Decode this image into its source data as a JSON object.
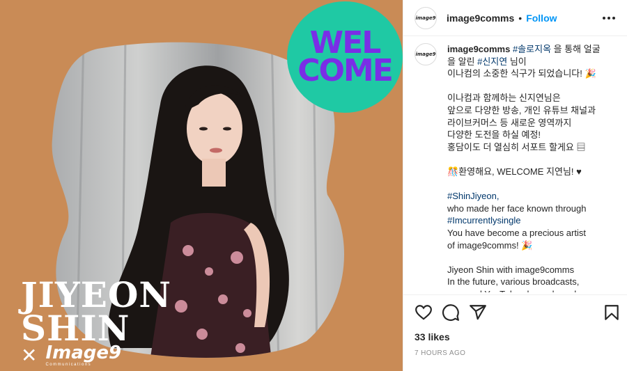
{
  "post": {
    "welcome": [
      "WEL",
      "COME"
    ],
    "name_lines": [
      "JIYEON",
      "SHIN"
    ],
    "x_mark": "✕",
    "brand_name": "Image9",
    "brand_sub": "Communications"
  },
  "header": {
    "avatar_text": "image9",
    "username": "image9comms",
    "separator": "•",
    "follow": "Follow",
    "more_icon": "more-horizontal-icon"
  },
  "caption": {
    "username": "image9comms",
    "lines": [
      [
        {
          "t": " "
        },
        {
          "t": "#솔로지옥",
          "tag": true
        },
        {
          "t": " 을 통해 얼굴"
        }
      ],
      [
        {
          "t": "을 알린 "
        },
        {
          "t": "#신지연",
          "tag": true
        },
        {
          "t": " 님이"
        }
      ],
      [
        {
          "t": "이나컴의 소중한 식구가 되었습니다! 🎉"
        }
      ],
      [],
      [
        {
          "t": "이나컴과 함께하는 신지연님은"
        }
      ],
      [
        {
          "t": "앞으로 다양한 방송, 개인 유튜브 채널과"
        }
      ],
      [
        {
          "t": "라이브커머스 등 새로운 영역까지"
        }
      ],
      [
        {
          "t": "다양한 도전을 하실 예정!"
        }
      ],
      [
        {
          "t": "홍담이도 더 열심히 서포트 할게요 ▤"
        }
      ],
      [],
      [
        {
          "t": "🎊환영해요, WELCOME 지연님! ♥"
        }
      ],
      [],
      [
        {
          "t": "#ShinJiyeon,",
          "tag": true
        }
      ],
      [
        {
          "t": "who made her face known through"
        }
      ],
      [
        {
          "t": "#Imcurrentlysingle",
          "tag": true
        }
      ],
      [
        {
          "t": "You have become a precious artist"
        }
      ],
      [
        {
          "t": "of image9comms! 🎉"
        }
      ],
      [],
      [
        {
          "t": "Jiyeon Shin with image9comms"
        }
      ],
      [
        {
          "t": "In the future, various broadcasts,"
        }
      ],
      [
        {
          "t": "personal YouTube channels and"
        }
      ]
    ]
  },
  "actions": {
    "like_icon": "heart-icon",
    "comment_icon": "comment-icon",
    "share_icon": "share-icon",
    "save_icon": "bookmark-icon"
  },
  "likes": "33 likes",
  "timestamp": "7 HOURS AGO",
  "colors": {
    "background_orange": "#c98b56",
    "welcome_green": "#1fc9a4",
    "welcome_purple": "#7a2ee6",
    "link_blue": "#0095f6",
    "hashtag_blue": "#00376b"
  }
}
